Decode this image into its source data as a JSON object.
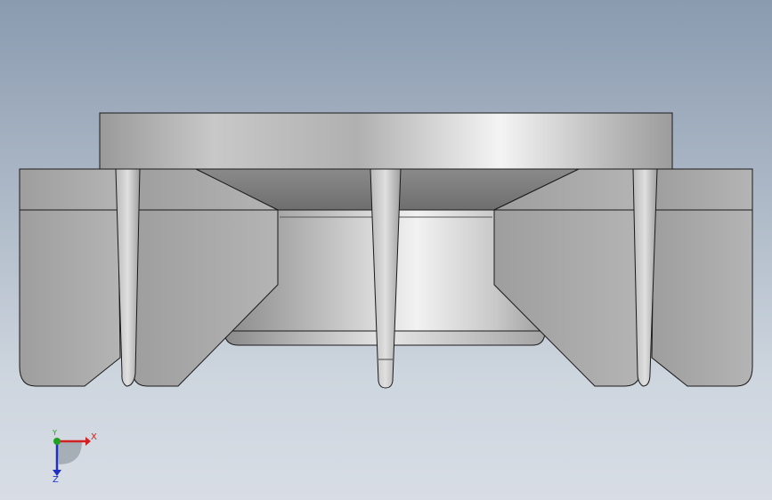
{
  "viewport": {
    "background_top": "#8a9bb0",
    "background_bottom": "#d8dde5"
  },
  "model": {
    "description_icon": "cad-part-front-view-icon"
  },
  "triad": {
    "x_label": "X",
    "y_label": "Y",
    "z_label": "Z",
    "x_color": "#d22020",
    "y_color": "#20a020",
    "z_color": "#2030c0"
  }
}
